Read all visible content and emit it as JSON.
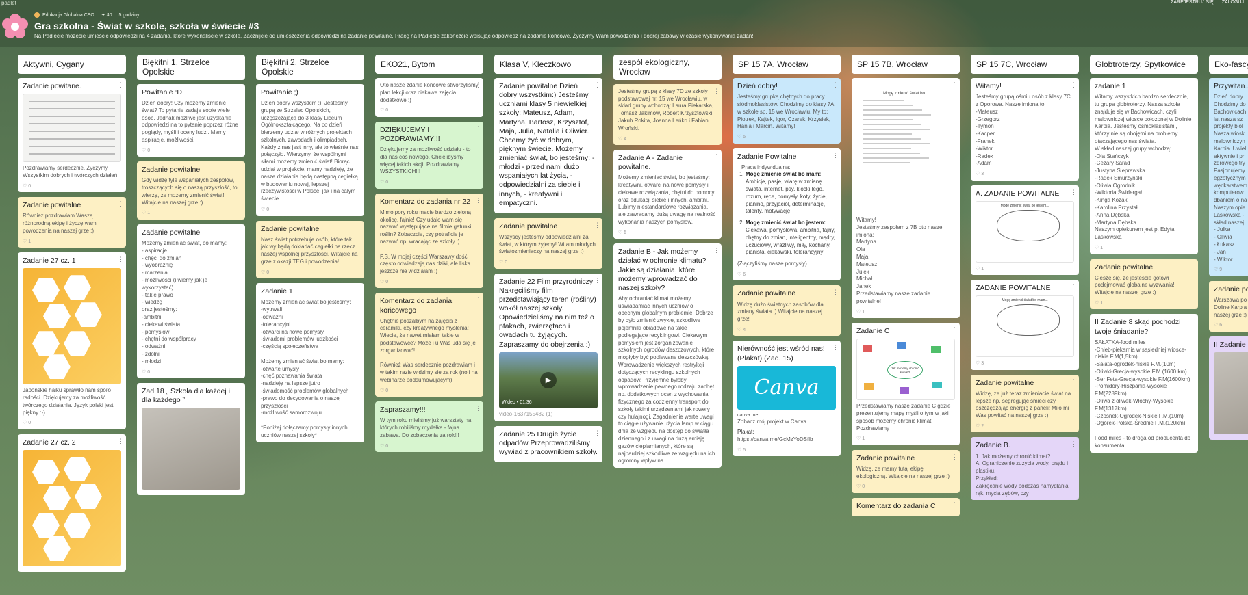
{
  "app": {
    "brand": "padlet"
  },
  "top_links": {
    "register": "ZAREJESTRUJ SIĘ",
    "login": "ZALOGUJ"
  },
  "header": {
    "author": "Edukacja Globalna CEO",
    "likes": "40",
    "time": "5 godziny",
    "title": "Gra szkolna - Świat w szkole, szkoła w świecie #3",
    "description": "Na Padlecie możecie umieścić odpowiedzi na 4 zadania, które wykonaliście w szkole. Zacznijcie od umieszczenia odpowiedzi na zadanie powitalne. Pracę na Padlecie zakończcie wpisując odpowiedź na zadanie końcowe. Życzymy Wam powodzenia i dobrej zabawy w czasie wykonywania zadań!"
  },
  "columns": [
    {
      "name": "Aktywni, Cygany",
      "posts": [
        {
          "color": "white",
          "title": "Zadanie powitane.",
          "image": "sketch",
          "body": "Pozdrawiamy serdecznie. Życzymy Wszystkim dobrych i twórczych działań.",
          "foot": "0"
        },
        {
          "color": "yellow",
          "title": "Zadanie powitalne",
          "body": "Również pozdrawiam Waszą różnorodną ekipę i życzę wam powodzenia na naszej grze :)",
          "foot": "1"
        },
        {
          "color": "white",
          "title": "Zadanie 27 cz. 1",
          "image": "honey",
          "body": "Japońskie haiku sprawiło nam sporo radości. Dziękujemy za możliwość twórczego działania. Język polski jest piękny :-)",
          "foot": "0"
        },
        {
          "color": "white",
          "title": "Zadanie 27 cz. 2",
          "image": "honey",
          "body": ""
        }
      ]
    },
    {
      "name": "Błękitni 1, Strzelce Opolskie",
      "posts": [
        {
          "color": "white",
          "title": "Powitanie :D",
          "body": "Dzień dobry! Czy możemy zmienić świat? To pytanie zadaje sobie wiele osób. Jednak możliwe jest uzyskanie odpowiedzi na to pytanie poprzez różne poglądy, myśli i oceny ludzi. Mamy aspiracje, możliwości.",
          "foot": "0"
        },
        {
          "color": "yellow",
          "title": "Zadanie powitalne",
          "body": "Gdy widzę tyle wspaniałych zespołów, troszczących się o naszą przyszłość, to wierzę, że możemy zmienić świat! Witajcie na naszej grze :)",
          "foot": "1"
        },
        {
          "color": "white",
          "title": "Zadanie powitalne",
          "body": "Możemy zmieniać świat, bo mamy:\n- aspiracje\n- chęci do zmian\n- wyobraźnię\n- marzenia\n- możliwości (i wiemy jak je wykorzystać)\n- takie prawo\n- wiedzę\noraz jesteśmy:\n-ambitni\n- ciekawi świata\n- pomysłowi\n- chętni do współpracy\n- odważni\n- zdolni\n- młodzi",
          "foot": "0"
        },
        {
          "color": "white",
          "title": "Zad 18 „ Szkoła dla każdej i dla każdego ”",
          "image": "paper",
          "body": ""
        }
      ]
    },
    {
      "name": "Błękitni 2, Strzelce Opolskie",
      "posts": [
        {
          "color": "white",
          "title": "Powitanie ;)",
          "body": "Dzień dobry wszystkim ;)! Jesteśmy grupą ze Strzelec Opolskich, uczęszczającą do 3 klasy Liceum Ogólnokształcącego. Na co dzień bierzemy udział w różnych projektach szkolnych, zawodach i olimpiadach. Każdy z nas jest inny, ale to właśnie nas połączyło. Wierzymy, że wspólnymi siłami możemy zmienić świat! Biorąc udział w projekcie, mamy nadzieję, że nasze działania będą następną cegiełką w budowaniu nowej, lepszej rzeczywistości w Polsce, jak i na całym świecie.",
          "foot": "0"
        },
        {
          "color": "yellow",
          "title": "Zadanie powitalne",
          "body": "Nasz świat potrzebuje osób, które tak jak wy będą dokładać cegiełki na rzecz naszej wspólnej przyszłości. Witajcie na grze z okazji TEG i powodzenia!",
          "foot": "0"
        },
        {
          "color": "white",
          "title": "Zadanie 1",
          "body": "Możemy zmieniać świat bo jesteśmy:\n-wytrwali\n-odważni\n-tolerancyjni\n-otwarci na nowe pomysły\n-świadomi problemów ludzkości\n-częścią społeczeństwa\n\nMożemy zmieniać świat bo mamy:\n-otwarte umysły\n-chęć poznawania świata\n-nadzieję na lepsze jutro\n-świadomość problemów globalnych\n-prawo do decydowania o naszej przyszłości\n-możliwość samorozwoju\n\n*Poniżej dołączamy pomysły innych uczniów naszej szkoły*",
          "foot": ""
        }
      ]
    },
    {
      "name": "EKO21, Bytom",
      "posts": [
        {
          "color": "white",
          "title": "",
          "body": "Oto nasze zdanie końcowe stworzyliśmy plan lekcji oraz ciekawe zajęcia dodatkowe :)",
          "foot": "0"
        },
        {
          "color": "green",
          "title": "DZIĘKUJEMY I POZDRAWIAMY!!!",
          "body": "Dziękujemy za możliwość udziału - to dla nas coś nowego. Chcielibyśmy więcej takich akcji. Pozdrawiamy WSZYSTKICH!!!",
          "foot": "0"
        },
        {
          "color": "yellow",
          "title": "Komentarz do zadania nr 22",
          "body": "Mimo pory roku macie bardzo zieloną okolicę, fajnie! Czy udało wam się nazwać występujące na filmie gatunki roślin? Zobaczcie, czy potraficie je nazwać np. wracając ze szkoły :)\n\nP.S. W mojej części Warszawy dość często odwiedzają nas dziki, ale liska jeszcze nie widziałam :)",
          "foot": "0"
        },
        {
          "color": "yellow",
          "title": "Komentarz do zadania końcowego",
          "body": "Chętnie poszalbym na zajęcia z ceramiki, czy kreatywnego myślenia! Wiecie, że nawet miałam takie w podstawówce? Może i u Was uda się je zorganizować!\n\nRównież Was serdecznie pozdrawiam i w takim razie widzimy się za rok (no i na webinarze podsumowującym)!",
          "foot": "0"
        },
        {
          "color": "green",
          "title": "Zapraszamy!!!",
          "body": "W tym roku mieliśmy już warsztaty na których robiliśmy mydełka - fajna zabawa. Do zobaczenia za rok!!!",
          "foot": "0"
        }
      ]
    },
    {
      "name": "Klasa V, Kleczkowo",
      "posts": [
        {
          "color": "white",
          "title": "Zadanie powitalne Dzień dobry wszystkim:) Jesteśmy uczniami klasy 5 niewielkiej szkoły: Mateusz, Adam, Martyna, Bartosz, Krzysztof, Maja, Julia, Natalia i Oliwier. Chcemy żyć w dobrym, pięknym świecie. Możemy zmieniać świat, bo jesteśmy: - młodzi - przed nami dużo wspaniałych lat życia, - odpowiedzialni za siebie i innych, - kreatywni i empatyczni.",
          "body": "",
          "foot": ""
        },
        {
          "color": "yellow",
          "title": "Zadanie powitalne",
          "body": "Wszyscy jesteśmy odpowiedzialni za świat, w którym żyjemy! Witam młodych światozmieniaczy na naszej grze :)",
          "foot": "0"
        },
        {
          "color": "white",
          "title": "Zadanie 22 Film przyrodniczy Nakręciliśmy film przedstawiający teren (rośliny) wokół naszej szkoły. Opowiedzieliśmy na nim też o ptakach, zwierzętach i owadach tu żyjących. Zapraszamy do obejrzenia :)",
          "image": "video",
          "video_label": "Wideo",
          "video_len": "01:36",
          "body": "video-1637155482 (1)",
          "foot": ""
        },
        {
          "color": "white",
          "title": "Zadanie 25 Drugie życie odpadów Przeprowadziliśmy wywiad z pracownikiem szkoły.",
          "body": ""
        }
      ]
    },
    {
      "name": "zespół ekologiczny, Wrocław",
      "posts": [
        {
          "color": "yellow",
          "title": "",
          "body": "Jesteśmy grupą z klasy 7D ze szkoły podstawowej nr. 15 we Wrocławiu, w skład grupy wchodzą: Laura Piekarska, Tomasz Jakimów, Robert Krzysztowski, Jakub Rokita, Joanna Leńko i Fabian Wroński.",
          "foot": "4"
        },
        {
          "color": "white",
          "title": "Zadanie A - Zadanie powitalne.",
          "body": "Możemy zmieniać świat, bo jesteśmy: kreatywni, otwarci na nowe pomysły i ciekawe rozwiązania, chętni do pomocy oraz edukacji siebie i innych, ambitni. Lubimy niestandardowe rozwiązania, ale zawracamy dużą uwagę na realność wykonania naszych pomysłów.",
          "foot": "5"
        },
        {
          "color": "white",
          "title": "Zadanie B - Jak możemy działać w ochronie klimatu? Jakie są działania, które możemy wprowadzać do naszej szkoły?",
          "body": "Aby ochraniać klimat możemy uświadamiać innych uczniów o obecnym globalnym problemie. Dobrze by było zmienić zwykłe, szkodliwe pojemniki obiadowe na takie podlegające recyklingowi. Ciekawym pomysłem jest zorganizowanie szkolnych ogrodów deszczowych, które mogłyby być podlewane deszczówką. Wprowadzenie większych restrykcji dotyczących recyklingu szkolnych odpadów. Przyjemne byłoby wprowadzenie pewnego rodzaju zachęt np. dodatkowych ocen z wychowania fizycznego za codzienny transport do szkoły takimi urządzeniami jak rowery czy hulajnogi. Zagadnienie warte uwagi to ciągłe używanie użycia lamp w ciągu dnia ze względu na dostęp do światła dziennego i z uwagi na dużą emisję gazów cieplarnianych, które są najbardziej szkodliwe ze względu na ich ogromny wpływ na",
          "foot": ""
        }
      ]
    },
    {
      "name": "SP 15 7A, Wrocław",
      "posts": [
        {
          "color": "blue",
          "title": "Dzień dobry!",
          "body": "Jesteśmy grupką chętnych do pracy siódmoklasistów. Chodzimy do klasy 7A w szkole sp. 15 we Wrocławiu. My to:\nPiotrek, Kajtek, Igor, Czarek, Krzysiek, Hania i Marcin. Witamy!",
          "foot": "5"
        },
        {
          "color": "white",
          "title": "Zadanie Powitalne",
          "subtitle": "Praca indywidualna:",
          "list": [
            {
              "lead": "Mogę zmienić świat bo mam:",
              "text": " Ambicje, pasje, wiarę w zmianę świata, internet, psy, klocki lego, rozum, ręce, pomysły, koty, życie, pianino, przyjaciół, determinację, talenty, motywację"
            },
            {
              "lead": "Mogę zmienić świat bo jestem:",
              "text": " Ciekawa, pomysłowa, ambitna, fajny, chętny do zmian, inteligentny, mądry, uczuciowy, wrażliwy, miły, kochany, pianista, ciekawski, tolerancyjny"
            }
          ],
          "body": "(Złączyliśmy nasze pomysły)",
          "foot": "6"
        },
        {
          "color": "yellow",
          "title": "Zadanie powitalne",
          "body": "Widzę dużo świetnych zasobów dla zmiany świata :) Witajcie na naszej grze!",
          "foot": "4"
        },
        {
          "color": "white",
          "title": "Nierówność jest wśród nas! (Plakat) (Zad. 15)",
          "image": "canva",
          "canva_text": "Canva",
          "canva_domain": "canva.me",
          "body": "Zobacz mój projekt w Canva.",
          "plakat_label": "Plakat:",
          "plakat_link": "https://canva.me/GcMzYoDSflb",
          "foot": "5"
        }
      ]
    },
    {
      "name": "SP 15 7B, Wrocław",
      "posts": [
        {
          "color": "white",
          "title": "",
          "image": "doc",
          "doc_title": "Mogę zmienić świat bo...",
          "body": "Witamy!\nJesteśmy zespołem z 7B oto nasze imiona:\nMartyna\nOla\nMaja\nMateusz\nJulek\nMichał\nJanek\nPrzedstawiamy nasze zadanie powitalne!",
          "foot": "1"
        },
        {
          "color": "white",
          "title": "Zadanie C",
          "image": "mind",
          "mind_label": "Jak możemy chronić klimat?",
          "body": "Przedstawiamy nasze zadanie C gdzie prezentujemy mapę myśli o tym w jaki sposób możemy chronić klimat.\nPozdrawiamy",
          "foot": "1"
        },
        {
          "color": "yellow",
          "title": "Zadanie powitalne",
          "body": "Widzę, że mamy tutaj ekipę ekologiczną. Witajcie na naszej grze :)",
          "foot": "0"
        },
        {
          "color": "yellow",
          "title": "Komentarz do zadania C",
          "body": ""
        }
      ]
    },
    {
      "name": "SP 15 7C, Wrocław",
      "posts": [
        {
          "color": "white",
          "title": "Witamy!",
          "body": "Jesteśmy grupą ośmiu osób z klasy 7C z Oporowa. Nasze imiona to:\n-Mateusz\n-Grzegorz\n-Tymon\n-Kacper\n-Franek\n-Wiktor\n-Radek\n-Adam",
          "foot": "3"
        },
        {
          "color": "white",
          "title": "A. ZADANIE POWITALNE",
          "image": "cloud",
          "cloud_text": "Mogę zmienić świat bo jestem...",
          "body": "",
          "foot": "1"
        },
        {
          "color": "white",
          "title": "ZADANIE POWITALNE",
          "image": "cloud",
          "cloud_text": "Mogę zmienić świat bo mam...",
          "body": "",
          "foot": "3"
        },
        {
          "color": "yellow",
          "title": "Zadanie powitalne",
          "body": "Widzę, że już teraz zmieniacie świat na lepsze np. segregując śmieci czy oszczędzając energię z paneli! Miło mi Was powitać na naszej grze :)",
          "foot": "2"
        },
        {
          "color": "purple",
          "title": "Zadanie B.",
          "body": "1. Jak możemy chronić klimat?\nA. Ograniczenie zużycia wody, prądu i plastiku.\nPrzykład:\nZakręcanie wody podczas namydlania rąk, mycia zębów, czy",
          "foot": ""
        }
      ]
    },
    {
      "name": "Globtroterzy, Spytkowice",
      "posts": [
        {
          "color": "white",
          "title": "zadanie 1",
          "body": "Witamy wszystkich bardzo serdecznie, tu grupa globtroterzy. Nasza szkoła znajduje się w Bachowicach, czyli malowniczej wiosce położonej w Dolinie Karpia. Jesteśmy ósmoklasistami, którzy nie są obojętni na problemy otaczającego nas świata.\nW skład naszej grupy wchodzą:\n-Ola Stańczyk\n-Cezary Sarad\n-Justyna Sieprawska\n-Radek Smurzyński\n-Oliwia Ogrodnik\n-Wiktoria Świdergał\n-Kinga Kozak\n-Karolina Przystał\n-Anna Dębska\n-Martyna Dębska\nNaszym opiekunem jest p. Edyta Laskowska",
          "foot": "1"
        },
        {
          "color": "yellow",
          "title": "Zadanie powitalne",
          "body": "Cieszę się, że jesteście gotowi podejmować globalne wyzwania! Witajcie na naszej grze :)",
          "foot": "1"
        },
        {
          "color": "white",
          "title": "II Zadanie 8 skąd pochodzi twoje śniadanie?",
          "body": "SAŁATKA-food miles\n-Chleb-piekarnia w sąsiedniej wiosce-niskie F.M(1,5km)\n-Sałata-ogródek-niskie F.M.(10m)\n-Oliwki-Grecja-wysokie F.M (1600 km)\n-Ser Feta-Grecja-wysokie F.M(1600km)\n-Pomidory-Hiszpania-wysokie F.M(2289km)\n-Oliwa z oliwek-Włochy-Wysokie F.M(1317km)\n-Czosnek-Ogródek-Niskie F.M.(10m)\n-Ogórek-Polska-Średnie F.M.(120km)\n\nFood miles - to droga od producenta do konsumenta",
          "foot": ""
        }
      ]
    },
    {
      "name": "Eko-fascy...",
      "posts": [
        {
          "color": "blue",
          "title": "Przywitan...",
          "body": "Dzień dobry\nChodzimy do\nBachowicach\nlat nasza sz\nprojekty biol\nNasza wiosk\nmalowniczyn\nKarpia. Uwiel\naktywnie i pr\nzdrowego try\nPasjonujemy\negzotycznym\nwędkarstwem\nkomputerow\ndbaniem o na\nNaszym opie\nLaskowska -\nskład naszej\n- Julka\n- Oliwia\n- Łukasz\n- Jan\n- Wiktor",
          "foot": "9"
        },
        {
          "color": "yellow",
          "title": "Zadanie po...",
          "body": "Warszawa po\nDoline Karpia\nnaszej grze :)",
          "foot": "6"
        },
        {
          "color": "purple",
          "title": "II Zadanie oaza bioró...",
          "image": "paper",
          "body": ""
        }
      ]
    }
  ]
}
